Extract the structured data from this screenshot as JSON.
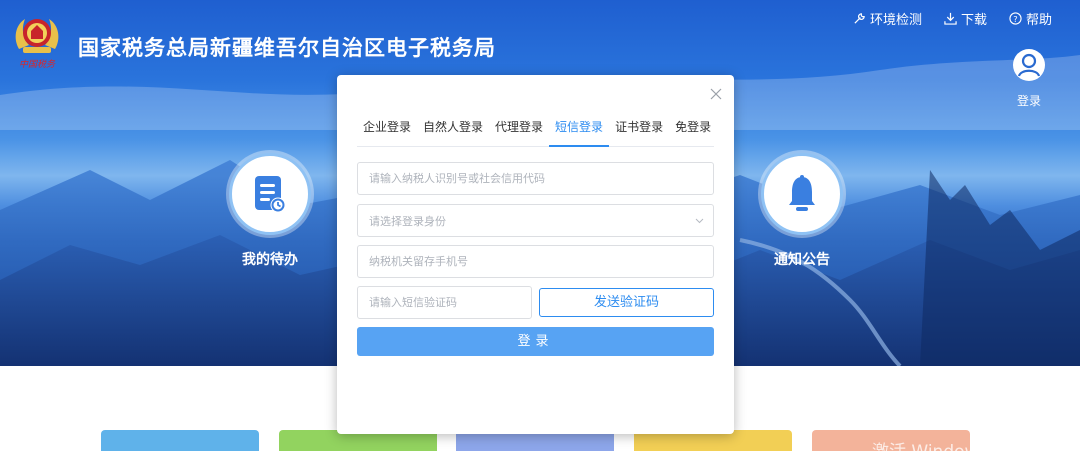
{
  "header": {
    "site_title": "国家税务总局新疆维吾尔自治区电子税务局",
    "emblem_text": "中国税务",
    "links": [
      {
        "label": "环境检测",
        "icon": "wrench-icon"
      },
      {
        "label": "下载",
        "icon": "download-icon"
      },
      {
        "label": "帮助",
        "icon": "help-circle-icon"
      }
    ],
    "login_label": "登录"
  },
  "features": {
    "todo_label": "我的待办",
    "notice_label": "通知公告"
  },
  "modal": {
    "tabs": [
      {
        "label": "企业登录",
        "active": false
      },
      {
        "label": "自然人登录",
        "active": false
      },
      {
        "label": "代理登录",
        "active": false
      },
      {
        "label": "短信登录",
        "active": true
      },
      {
        "label": "证书登录",
        "active": false
      },
      {
        "label": "免登录",
        "active": false
      }
    ],
    "taxpayer_id_placeholder": "请输入纳税人识别号或社会信用代码",
    "identity_select_placeholder": "请选择登录身份",
    "phone_placeholder": "纳税机关留存手机号",
    "code_placeholder": "请输入短信验证码",
    "send_code_label": "发送验证码",
    "login_button_label": "登录"
  },
  "watermark": "激活 Windows",
  "colors": {
    "accent": "#2d8cf0",
    "login_button": "#57a3f3",
    "tile_colors": [
      "#5fb2ea",
      "#92d35f",
      "#8da6ea",
      "#f2cf55",
      "#f3b39a"
    ]
  }
}
